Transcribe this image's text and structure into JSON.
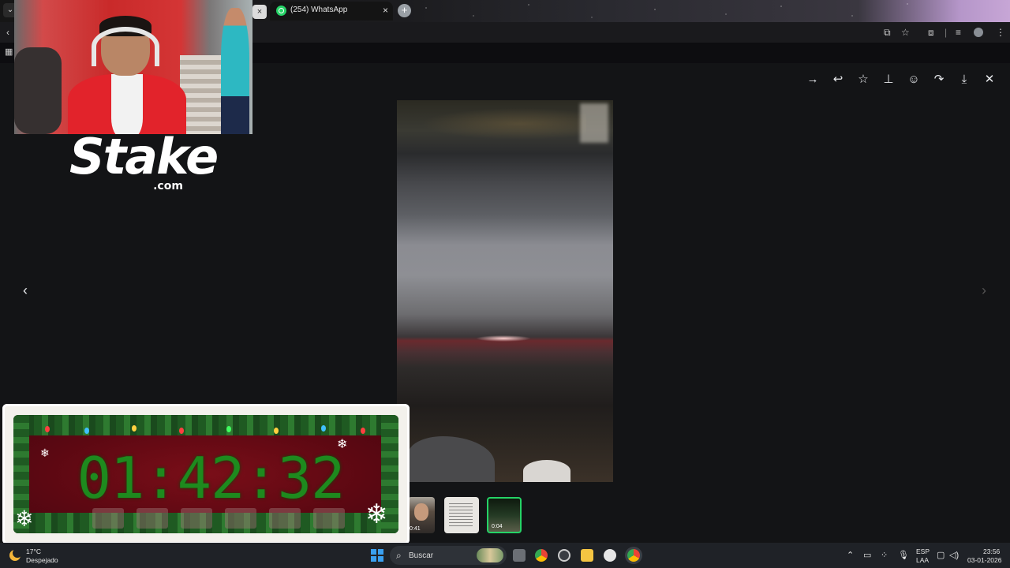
{
  "browser": {
    "tab_title": "(254) WhatsApp",
    "tab_close": "×",
    "prev_tab_close": "×",
    "new_tab": "+",
    "window_menu": "⌄"
  },
  "viewer": {
    "toolbar_icons": [
      "arrow-right-icon",
      "reply-icon",
      "star-icon",
      "pin-icon",
      "emoji-icon",
      "forward-icon",
      "download-icon",
      "close-icon"
    ],
    "prev_arrow": "‹",
    "next_arrow": "›",
    "thumbnails": [
      {
        "name": "thumb-photo",
        "duration": "0:41"
      },
      {
        "name": "thumb-document",
        "duration": ""
      },
      {
        "name": "thumb-video-selected",
        "duration": "0:04"
      }
    ]
  },
  "overlay": {
    "brand": "Stake",
    "brand_suffix": ".com",
    "timer": "01:42:32"
  },
  "taskbar": {
    "temperature": "17°C",
    "weather": "Despejado",
    "search_label": "Buscar",
    "language": "ESP",
    "language_sub": "LAA",
    "time": "23:56",
    "date": "03-01-2026"
  },
  "colors": {
    "whatsapp_green": "#25d366",
    "timer_green": "#1e8a1e",
    "viewer_bg": "#131416"
  }
}
